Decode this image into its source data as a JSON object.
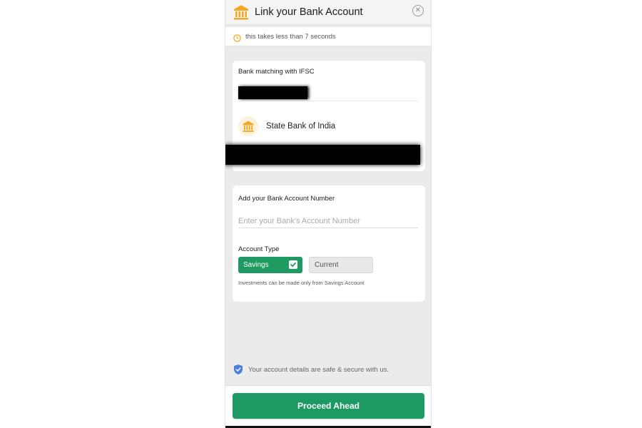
{
  "header": {
    "title": "Link your Bank Account",
    "logo_icon": "bank-icon",
    "close_icon": "close-icon",
    "close_glyph": "✕"
  },
  "subheader": {
    "icon": "clock-icon",
    "text": "this takes less than 7 seconds"
  },
  "bank_card": {
    "label": "Bank matching with IFSC",
    "bank_icon": "bank-icon",
    "bank_name": "State Bank of India"
  },
  "account_card": {
    "label": "Add your Bank Account Number",
    "input_placeholder": "Enter your Bank's Account Number",
    "input_value": "",
    "type_label": "Account Type",
    "types": [
      {
        "label": "Savings",
        "selected": true
      },
      {
        "label": "Current",
        "selected": false
      }
    ],
    "note": "Investments can be made only from Savings Account"
  },
  "security": {
    "icon": "shield-icon",
    "text": "Your account details are safe & secure with us."
  },
  "proceed_button": {
    "label": "Proceed Ahead"
  },
  "colors": {
    "accent_green": "#1d9a63",
    "bank_gold": "#f5a623",
    "shield_blue": "#4a7fe0",
    "background": "#ebebeb"
  }
}
